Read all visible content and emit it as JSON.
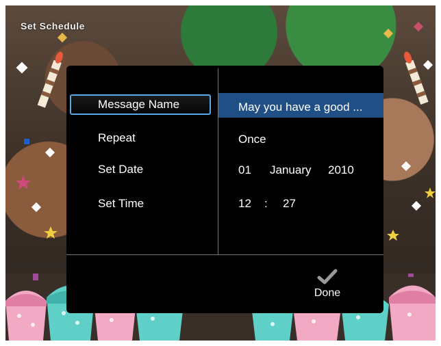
{
  "frame": {
    "title": "Set Schedule"
  },
  "dialog": {
    "rows": [
      {
        "label": "Message Name",
        "value": "May you have a good ..."
      },
      {
        "label": "Repeat",
        "value": "Once"
      },
      {
        "label": "Set Date",
        "day": "01",
        "month": "January",
        "year": "2010"
      },
      {
        "label": "Set Time",
        "hour": "12",
        "separator": ":",
        "minute": "27"
      }
    ],
    "done": {
      "label": "Done",
      "icon": "checkmark-icon"
    }
  },
  "colors": {
    "dialog_bg": "#000000",
    "selection_bg": "#204f86",
    "focus_border": "#5aa9e6"
  }
}
